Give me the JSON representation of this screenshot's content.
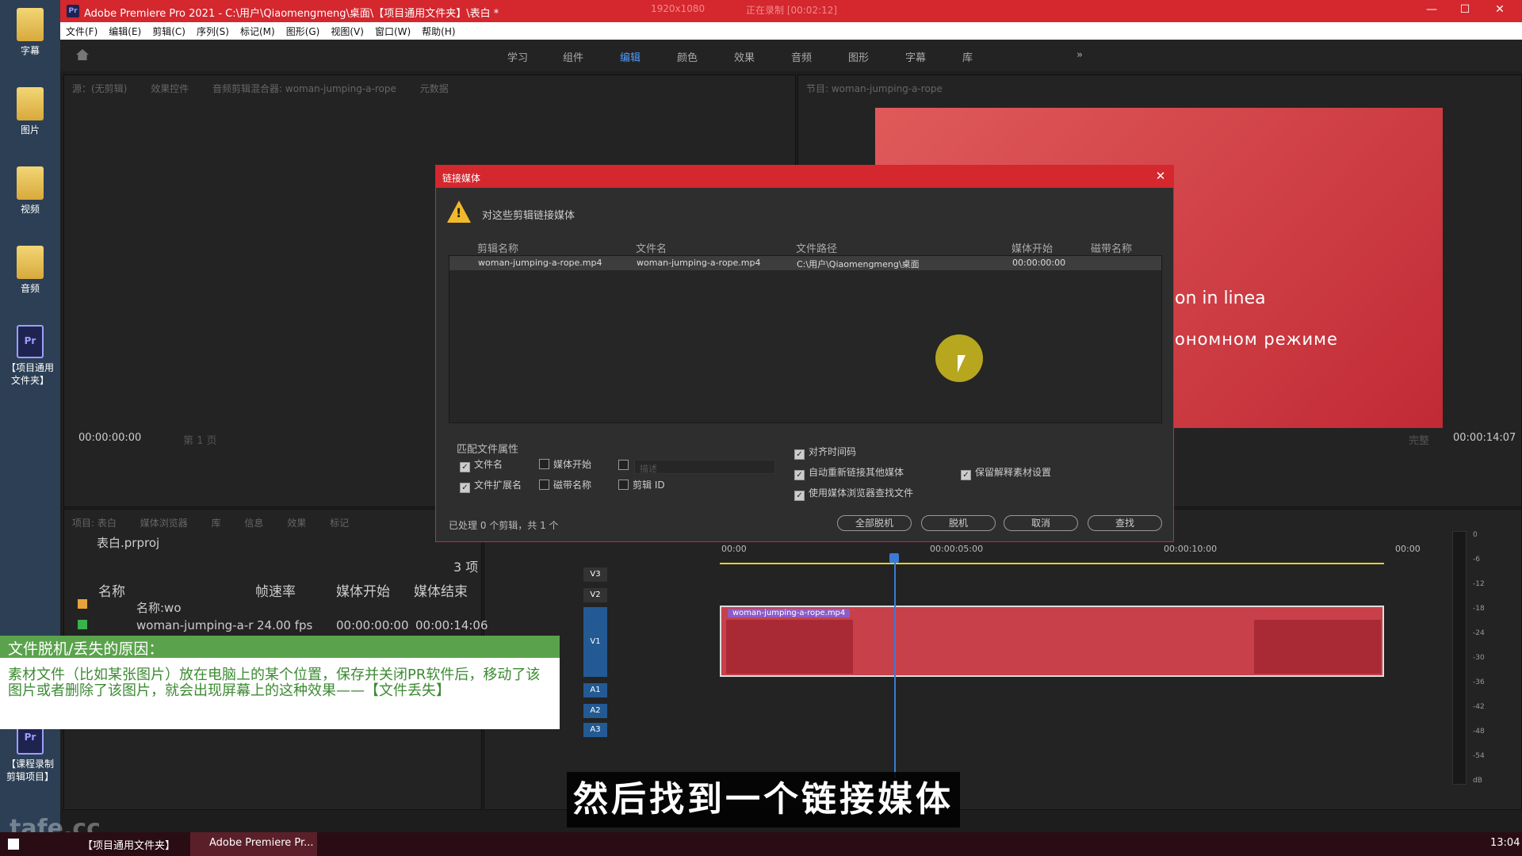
{
  "desktop": {
    "icons": [
      {
        "label": "字幕"
      },
      {
        "label": "图片"
      },
      {
        "label": "视频"
      },
      {
        "label": "音频"
      },
      {
        "label": "【项目通用文件夹】"
      },
      {
        "label": "【课程录制剪辑项目】"
      }
    ]
  },
  "titlebar": {
    "title": "Adobe Premiere Pro 2021 - C:\\用户\\Qiaomengmeng\\桌面\\【项目通用文件夹】\\表白 *",
    "recording_size": "1920x1080",
    "recording_status": "正在录制 [00:02:12]"
  },
  "menu": [
    "文件(F)",
    "编辑(E)",
    "剪辑(C)",
    "序列(S)",
    "标记(M)",
    "图形(G)",
    "视图(V)",
    "窗口(W)",
    "帮助(H)"
  ],
  "workspaces": {
    "tabs": [
      "学习",
      "组件",
      "编辑",
      "颜色",
      "效果",
      "音频",
      "图形",
      "字幕",
      "库"
    ],
    "active": "编辑",
    "more": "»"
  },
  "source_monitor": {
    "tabs": [
      "源：(无剪辑)",
      "效果控件",
      "音频剪辑混合器: woman-jumping-a-rope",
      "元数据"
    ],
    "timecode": "00:00:00:00",
    "page": "第 1 页"
  },
  "program_monitor": {
    "tab": "节目: woman-jumping-a-rope",
    "video_line1": "on in linea",
    "video_line2": "ономном режиме",
    "fit": "完整",
    "timecode": "00:00:14:07"
  },
  "project_panel": {
    "tabs": [
      "项目: 表白",
      "媒体浏览器",
      "库",
      "信息",
      "效果",
      "标记"
    ],
    "project_file": "表白.prproj",
    "item_count": "3 项",
    "columns": [
      "名称",
      "帧速率",
      "媒体开始",
      "媒体结束"
    ],
    "rows": [
      {
        "name": "名称:wo",
        "fps": "",
        "start": "",
        "end": ""
      },
      {
        "name": "woman-jumping-a-r",
        "fps": "24.00 fps",
        "start": "00:00:00:00",
        "end": "00:00:14:06"
      }
    ],
    "colors": {
      "bin": "#e8a23a",
      "clip": "#38b24a"
    }
  },
  "note": {
    "heading": "文件脱机/丢失的原因：",
    "body": "素材文件（比如某张图片）放在电脑上的某个位置，保存并关闭PR软件后，移动了该图片或者删除了该图片，就会出现屏幕上的这种效果——【文件丢失】"
  },
  "timeline": {
    "ruler": [
      "00:00",
      "00:00:05:00",
      "00:00:10:00",
      "00:00"
    ],
    "tracks_video": [
      "V3",
      "V2",
      "V1"
    ],
    "tracks_audio": [
      "A1",
      "A2",
      "A3"
    ],
    "clip_name": "woman-jumping-a-rope.mp4",
    "meter_ticks": [
      "0",
      "-6",
      "-12",
      "-18",
      "-24",
      "-30",
      "-36",
      "-42",
      "-48",
      "-54",
      "dB"
    ]
  },
  "dialog": {
    "title": "链接媒体",
    "message": "对这些剪辑链接媒体",
    "columns": [
      "剪辑名称",
      "文件名",
      "文件路径",
      "媒体开始",
      "磁带名称"
    ],
    "row": {
      "clip": "woman-jumping-a-rope.mp4",
      "file": "woman-jumping-a-rope.mp4",
      "path": "C:\\用户\\Qiaomengmeng\\桌面",
      "start": "00:00:00:00",
      "tape": ""
    },
    "match_label": "匹配文件属性",
    "match_options": [
      {
        "label": "文件名",
        "checked": true
      },
      {
        "label": "媒体开始",
        "checked": false
      },
      {
        "label": "描述",
        "checked": false
      },
      {
        "label": "文件扩展名",
        "checked": true
      },
      {
        "label": "磁带名称",
        "checked": false
      },
      {
        "label": "剪辑 ID",
        "checked": false
      }
    ],
    "right_options": [
      {
        "label": "对齐时间码",
        "checked": true
      },
      {
        "label": "自动重新链接其他媒体",
        "checked": true
      },
      {
        "label": "保留解释素材设置",
        "checked": true
      },
      {
        "label": "使用媒体浏览器查找文件",
        "checked": true
      }
    ],
    "status": "已处理 0 个剪辑，共 1 个",
    "buttons": [
      "全部脱机",
      "脱机",
      "取消",
      "查找"
    ]
  },
  "subtitle": "然后找到一个链接媒体",
  "watermark": "tafe.cc",
  "taskbar": {
    "items": [
      "【项目通用文件夹】",
      "Adobe Premiere Pr..."
    ],
    "clock": "13:04"
  }
}
